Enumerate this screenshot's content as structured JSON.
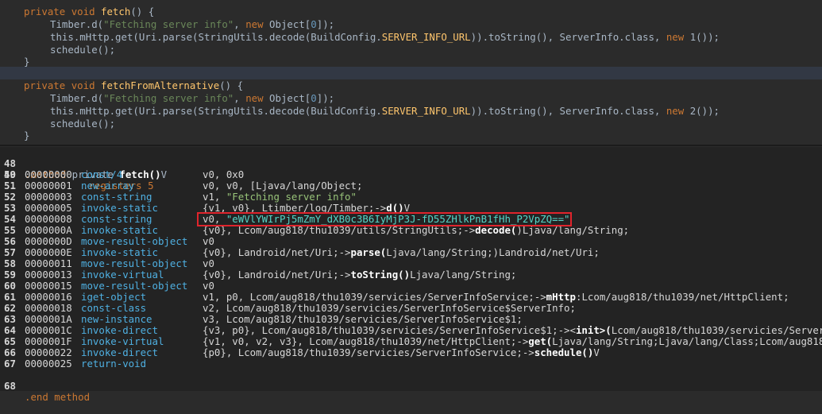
{
  "java": {
    "fetch": {
      "sig_kw1": "private",
      "sig_kw2": "void",
      "sig_name": "fetch",
      "sig_rest": "() {",
      "timber": "Timber.d(",
      "timber_str": "\"Fetching server info\"",
      "timber_mid": ", ",
      "timber_new": "new",
      "timber_obj": " Object[",
      "timber_zero": "0",
      "timber_end": "]);",
      "http_pre": "this.mHttp.get(Uri.parse(StringUtils.decode(BuildConfig.",
      "http_const": "SERVER_INFO_URL",
      "http_mid": ")).toString(), ServerInfo.class, ",
      "http_new": "new",
      "http_end": " 1());",
      "schedule": "schedule();",
      "close": "}"
    },
    "alt": {
      "sig_kw1": "private",
      "sig_kw2": "void",
      "sig_name": "fetchFromAlternative",
      "sig_rest": "() {",
      "timber": "Timber.d(",
      "timber_str": "\"Fetching server info\"",
      "timber_mid": ", ",
      "timber_new": "new",
      "timber_obj": " Object[",
      "timber_zero": "0",
      "timber_end": "]);",
      "http_pre": "this.mHttp.get(Uri.parse(StringUtils.decode(BuildConfig.",
      "http_const": "SERVER_INFO_URL",
      "http_mid": ")).toString(), ServerInfo.class, ",
      "http_new": "new",
      "http_end": " 2());",
      "schedule": "schedule();",
      "close": "}"
    }
  },
  "smali": {
    "l48": {
      "ln": "48",
      "dir": ".method",
      "rest": " private ",
      "name": "fetch()",
      "ret": "V"
    },
    "l49": {
      "ln": "49",
      "dir": ".registers",
      "val": " 5"
    },
    "rows": [
      {
        "ln": "50",
        "addr": "00000000",
        "op": "const/4",
        "args": "v0, 0x0"
      },
      {
        "ln": "51",
        "addr": "00000001",
        "op": "new-array",
        "args": "v0, v0, [Ljava/lang/Object;"
      },
      {
        "ln": "52",
        "addr": "00000003",
        "op": "const-string",
        "args_pre": "v1, ",
        "args_str": "\"Fetching server info\""
      },
      {
        "ln": "53",
        "addr": "00000005",
        "op": "invoke-static",
        "args_pre": "{v1, v0}, Ltimber/log/Timber;->",
        "args_m": "d()",
        "args_post": "V"
      },
      {
        "ln": "54",
        "addr": "00000008",
        "op": "const-string",
        "args_pre": "v0, ",
        "args_str": "\"eWVlYWIrPj5mZmY_dXB0c3B6IyMjP3J-fD55ZHlkPnB1fHh_P2VpZQ==\""
      },
      {
        "ln": "55",
        "addr": "0000000A",
        "op": "invoke-static",
        "args_pre": "{v0}, Lcom/aug818/thu1039/utils/StringUtils;->",
        "args_m": "decode(",
        "args_post": ")Ljava/lang/String;"
      },
      {
        "ln": "56",
        "addr": "0000000D",
        "op": "move-result-object",
        "args": "v0"
      },
      {
        "ln": "57",
        "addr": "0000000E",
        "op": "invoke-static",
        "args_pre": "{v0}, Landroid/net/Uri;->",
        "args_m": "parse(",
        "args_post": "Ljava/lang/String;)Landroid/net/Uri;"
      },
      {
        "ln": "58",
        "addr": "00000011",
        "op": "move-result-object",
        "args": "v0"
      },
      {
        "ln": "59",
        "addr": "00000013",
        "op": "invoke-virtual",
        "args_pre": "{v0}, Landroid/net/Uri;->",
        "args_m": "toString()",
        "args_post": "Ljava/lang/String;"
      },
      {
        "ln": "60",
        "addr": "00000015",
        "op": "move-result-object",
        "args": "v0"
      },
      {
        "ln": "61",
        "addr": "00000016",
        "op": "iget-object",
        "args_pre": "v1, p0, Lcom/aug818/thu1039/servicies/ServerInfoService;->",
        "args_m": "mHttp",
        "args_post": ":Lcom/aug818/thu1039/net/HttpClient;"
      },
      {
        "ln": "62",
        "addr": "00000018",
        "op": "const-class",
        "args": "v2, Lcom/aug818/thu1039/servicies/ServerInfoService$ServerInfo;"
      },
      {
        "ln": "63",
        "addr": "0000001A",
        "op": "new-instance",
        "args": "v3, Lcom/aug818/thu1039/servicies/ServerInfoService$1;"
      },
      {
        "ln": "64",
        "addr": "0000001C",
        "op": "invoke-direct",
        "args_pre": "{v3, p0}, Lcom/aug818/thu1039/servicies/ServerInfoService$1;-><",
        "args_m": "init>(",
        "args_post": "Lcom/aug818/thu1039/servicies/ServerInf"
      },
      {
        "ln": "65",
        "addr": "0000001F",
        "op": "invoke-virtual",
        "args_pre": "{v1, v0, v2, v3}, Lcom/aug818/thu1039/net/HttpClient;->",
        "args_m": "get(",
        "args_post": "Ljava/lang/String;Ljava/lang/Class;Lcom/aug818/th"
      },
      {
        "ln": "66",
        "addr": "00000022",
        "op": "invoke-direct",
        "args_pre": "{p0}, Lcom/aug818/thu1039/servicies/ServerInfoService;->",
        "args_m": "schedule()",
        "args_post": "V"
      },
      {
        "ln": "67",
        "addr": "00000025",
        "op": "return-void",
        "args": ""
      }
    ],
    "l68": {
      "ln": "68",
      "dir": ".end method"
    }
  },
  "colors": {
    "highlight_box": "#e0242c",
    "opcode": "#4fb0e2",
    "background": "#2b2b2b"
  }
}
